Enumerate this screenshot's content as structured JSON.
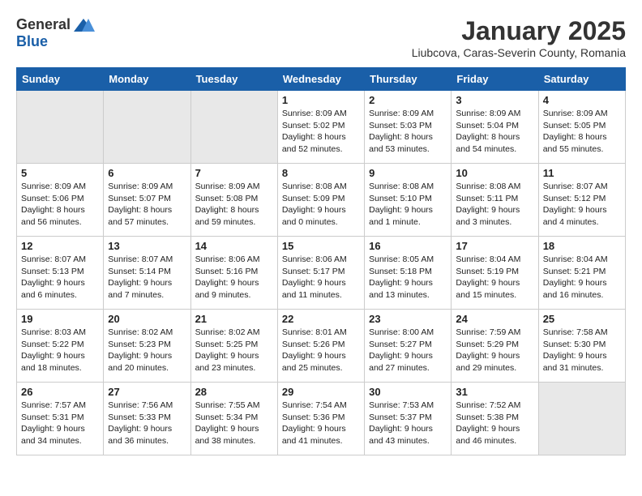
{
  "logo": {
    "general": "General",
    "blue": "Blue"
  },
  "title": "January 2025",
  "location": "Liubcova, Caras-Severin County, Romania",
  "days_of_week": [
    "Sunday",
    "Monday",
    "Tuesday",
    "Wednesday",
    "Thursday",
    "Friday",
    "Saturday"
  ],
  "weeks": [
    [
      {
        "day": "",
        "info": "",
        "empty": true
      },
      {
        "day": "",
        "info": "",
        "empty": true
      },
      {
        "day": "",
        "info": "",
        "empty": true
      },
      {
        "day": "1",
        "info": "Sunrise: 8:09 AM\nSunset: 5:02 PM\nDaylight: 8 hours\nand 52 minutes."
      },
      {
        "day": "2",
        "info": "Sunrise: 8:09 AM\nSunset: 5:03 PM\nDaylight: 8 hours\nand 53 minutes."
      },
      {
        "day": "3",
        "info": "Sunrise: 8:09 AM\nSunset: 5:04 PM\nDaylight: 8 hours\nand 54 minutes."
      },
      {
        "day": "4",
        "info": "Sunrise: 8:09 AM\nSunset: 5:05 PM\nDaylight: 8 hours\nand 55 minutes."
      }
    ],
    [
      {
        "day": "5",
        "info": "Sunrise: 8:09 AM\nSunset: 5:06 PM\nDaylight: 8 hours\nand 56 minutes."
      },
      {
        "day": "6",
        "info": "Sunrise: 8:09 AM\nSunset: 5:07 PM\nDaylight: 8 hours\nand 57 minutes."
      },
      {
        "day": "7",
        "info": "Sunrise: 8:09 AM\nSunset: 5:08 PM\nDaylight: 8 hours\nand 59 minutes."
      },
      {
        "day": "8",
        "info": "Sunrise: 8:08 AM\nSunset: 5:09 PM\nDaylight: 9 hours\nand 0 minutes."
      },
      {
        "day": "9",
        "info": "Sunrise: 8:08 AM\nSunset: 5:10 PM\nDaylight: 9 hours\nand 1 minute."
      },
      {
        "day": "10",
        "info": "Sunrise: 8:08 AM\nSunset: 5:11 PM\nDaylight: 9 hours\nand 3 minutes."
      },
      {
        "day": "11",
        "info": "Sunrise: 8:07 AM\nSunset: 5:12 PM\nDaylight: 9 hours\nand 4 minutes."
      }
    ],
    [
      {
        "day": "12",
        "info": "Sunrise: 8:07 AM\nSunset: 5:13 PM\nDaylight: 9 hours\nand 6 minutes."
      },
      {
        "day": "13",
        "info": "Sunrise: 8:07 AM\nSunset: 5:14 PM\nDaylight: 9 hours\nand 7 minutes."
      },
      {
        "day": "14",
        "info": "Sunrise: 8:06 AM\nSunset: 5:16 PM\nDaylight: 9 hours\nand 9 minutes."
      },
      {
        "day": "15",
        "info": "Sunrise: 8:06 AM\nSunset: 5:17 PM\nDaylight: 9 hours\nand 11 minutes."
      },
      {
        "day": "16",
        "info": "Sunrise: 8:05 AM\nSunset: 5:18 PM\nDaylight: 9 hours\nand 13 minutes."
      },
      {
        "day": "17",
        "info": "Sunrise: 8:04 AM\nSunset: 5:19 PM\nDaylight: 9 hours\nand 15 minutes."
      },
      {
        "day": "18",
        "info": "Sunrise: 8:04 AM\nSunset: 5:21 PM\nDaylight: 9 hours\nand 16 minutes."
      }
    ],
    [
      {
        "day": "19",
        "info": "Sunrise: 8:03 AM\nSunset: 5:22 PM\nDaylight: 9 hours\nand 18 minutes."
      },
      {
        "day": "20",
        "info": "Sunrise: 8:02 AM\nSunset: 5:23 PM\nDaylight: 9 hours\nand 20 minutes."
      },
      {
        "day": "21",
        "info": "Sunrise: 8:02 AM\nSunset: 5:25 PM\nDaylight: 9 hours\nand 23 minutes."
      },
      {
        "day": "22",
        "info": "Sunrise: 8:01 AM\nSunset: 5:26 PM\nDaylight: 9 hours\nand 25 minutes."
      },
      {
        "day": "23",
        "info": "Sunrise: 8:00 AM\nSunset: 5:27 PM\nDaylight: 9 hours\nand 27 minutes."
      },
      {
        "day": "24",
        "info": "Sunrise: 7:59 AM\nSunset: 5:29 PM\nDaylight: 9 hours\nand 29 minutes."
      },
      {
        "day": "25",
        "info": "Sunrise: 7:58 AM\nSunset: 5:30 PM\nDaylight: 9 hours\nand 31 minutes."
      }
    ],
    [
      {
        "day": "26",
        "info": "Sunrise: 7:57 AM\nSunset: 5:31 PM\nDaylight: 9 hours\nand 34 minutes."
      },
      {
        "day": "27",
        "info": "Sunrise: 7:56 AM\nSunset: 5:33 PM\nDaylight: 9 hours\nand 36 minutes."
      },
      {
        "day": "28",
        "info": "Sunrise: 7:55 AM\nSunset: 5:34 PM\nDaylight: 9 hours\nand 38 minutes."
      },
      {
        "day": "29",
        "info": "Sunrise: 7:54 AM\nSunset: 5:36 PM\nDaylight: 9 hours\nand 41 minutes."
      },
      {
        "day": "30",
        "info": "Sunrise: 7:53 AM\nSunset: 5:37 PM\nDaylight: 9 hours\nand 43 minutes."
      },
      {
        "day": "31",
        "info": "Sunrise: 7:52 AM\nSunset: 5:38 PM\nDaylight: 9 hours\nand 46 minutes."
      },
      {
        "day": "",
        "info": "",
        "empty": true
      }
    ]
  ]
}
